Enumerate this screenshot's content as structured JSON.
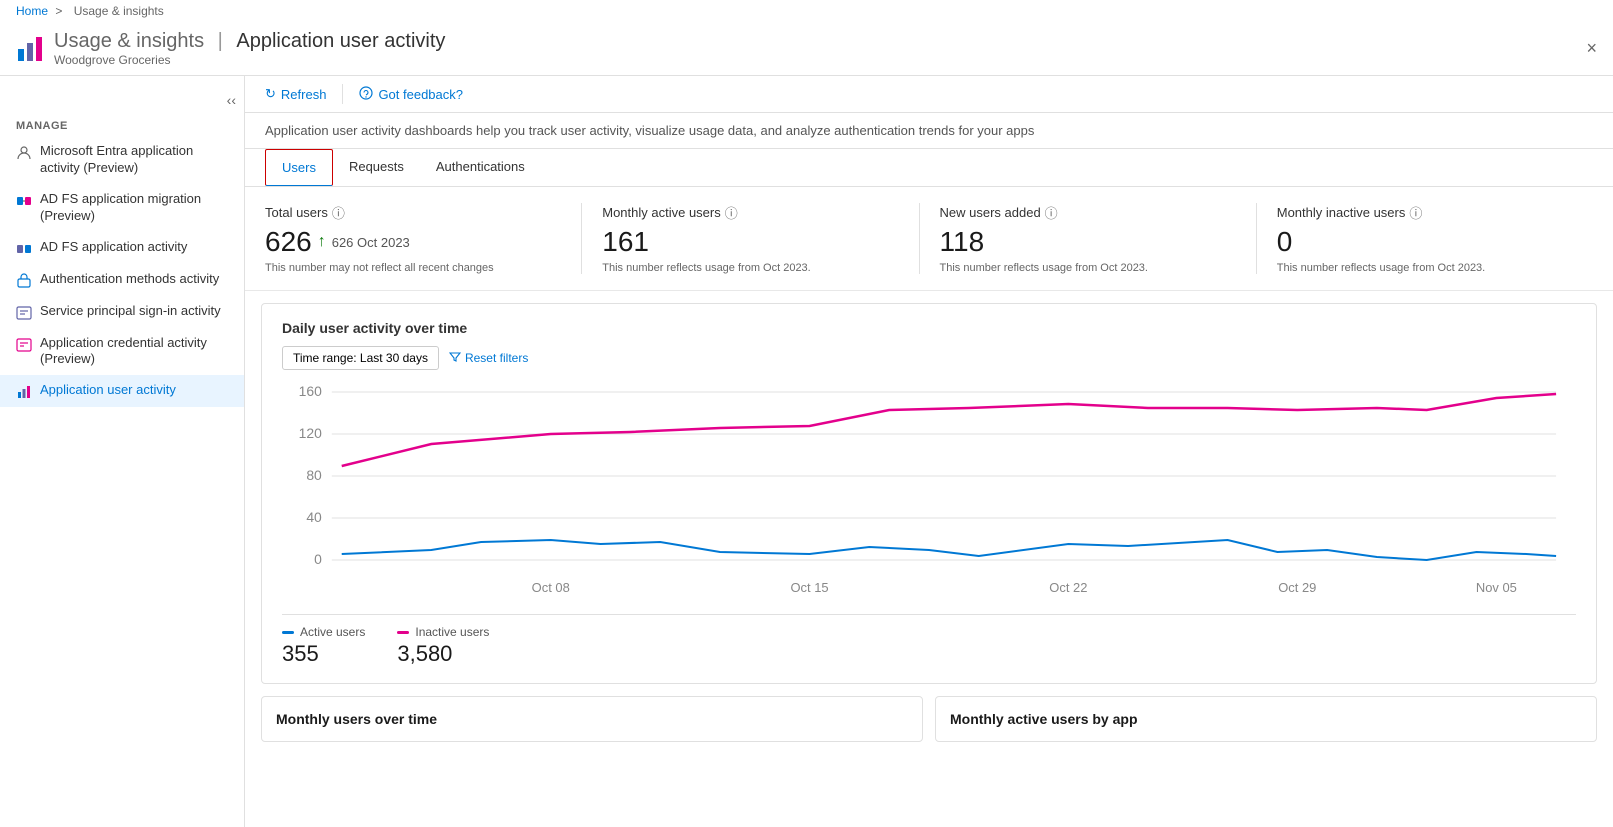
{
  "breadcrumb": {
    "home": "Home",
    "separator": ">",
    "current": "Usage & insights"
  },
  "header": {
    "title": "Usage & insights",
    "separator": "|",
    "subtitle": "Application user activity",
    "org": "Woodgrove Groceries",
    "close_label": "×"
  },
  "sidebar": {
    "section_title": "Manage",
    "items": [
      {
        "id": "entra-app",
        "label": "Microsoft Entra application activity (Preview)",
        "icon": "person-icon",
        "active": false
      },
      {
        "id": "adfs-migration",
        "label": "AD FS application migration (Preview)",
        "icon": "adfs-icon",
        "active": false
      },
      {
        "id": "adfs-activity",
        "label": "AD FS application activity",
        "icon": "adfs2-icon",
        "active": false
      },
      {
        "id": "auth-methods",
        "label": "Authentication methods activity",
        "icon": "auth-icon",
        "active": false
      },
      {
        "id": "service-principal",
        "label": "Service principal sign-in activity",
        "icon": "sp-icon",
        "active": false
      },
      {
        "id": "app-credential",
        "label": "Application credential activity (Preview)",
        "icon": "cred-icon",
        "active": false
      },
      {
        "id": "app-user",
        "label": "Application user activity",
        "icon": "app-icon",
        "active": true
      }
    ]
  },
  "toolbar": {
    "refresh_label": "Refresh",
    "feedback_label": "Got feedback?"
  },
  "description": "Application user activity dashboards help you track user activity, visualize usage data, and analyze authentication trends for your apps",
  "tabs": {
    "items": [
      {
        "id": "users",
        "label": "Users",
        "active": true
      },
      {
        "id": "requests",
        "label": "Requests",
        "active": false
      },
      {
        "id": "authentications",
        "label": "Authentications",
        "active": false
      }
    ]
  },
  "stats": [
    {
      "label": "Total users",
      "value": "626",
      "arrow": "↑",
      "change": "626 Oct 2023",
      "note": "This number may not reflect all recent changes"
    },
    {
      "label": "Monthly active users",
      "value": "161",
      "change": "",
      "note": "This number reflects usage from Oct 2023."
    },
    {
      "label": "New users added",
      "value": "118",
      "change": "",
      "note": "This number reflects usage from Oct 2023."
    },
    {
      "label": "Monthly inactive users",
      "value": "0",
      "change": "",
      "note": "This number reflects usage from Oct 2023."
    }
  ],
  "chart": {
    "title": "Daily user activity over time",
    "time_range_label": "Time range: Last 30 days",
    "reset_label": "Reset filters",
    "x_labels": [
      "Oct 08",
      "Oct 15",
      "Oct 22",
      "Oct 29",
      "Nov 05"
    ],
    "y_labels": [
      "0",
      "40",
      "80",
      "120",
      "160"
    ],
    "active_line_color": "#0078d4",
    "inactive_line_color": "#e3008c",
    "legend": {
      "active_label": "Active users",
      "active_value": "355",
      "active_color": "#0078d4",
      "inactive_label": "Inactive users",
      "inactive_value": "3,580",
      "inactive_color": "#e3008c"
    }
  },
  "bottom_charts": [
    {
      "id": "monthly-users",
      "title": "Monthly users over time"
    },
    {
      "id": "monthly-by-app",
      "title": "Monthly active users by app"
    }
  ]
}
